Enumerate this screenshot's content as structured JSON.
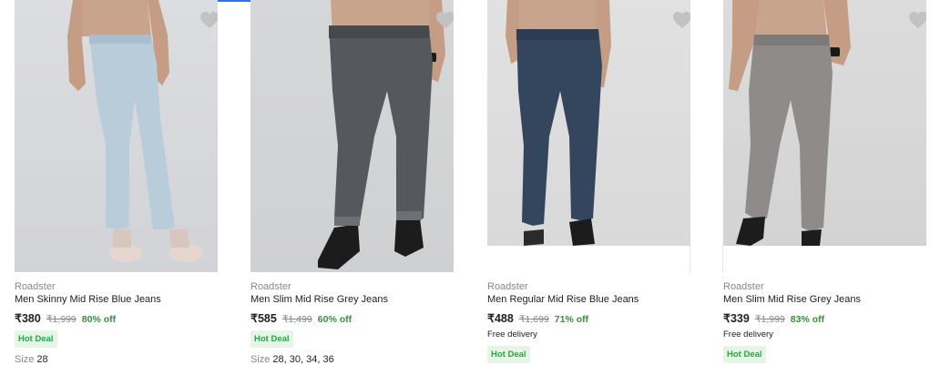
{
  "products": [
    {
      "brand": "Roadster",
      "title": "Men Skinny Mid Rise Blue Jeans",
      "price": "₹380",
      "mrp": "₹1,999",
      "discount": "80% off",
      "delivery": "",
      "badge": "Hot Deal",
      "size_label": "Size",
      "sizes": "28",
      "image_icon": "jeans-light-blue",
      "denim_color": "#b9ccd9"
    },
    {
      "brand": "Roadster",
      "title": "Men Slim Mid Rise Grey Jeans",
      "price": "₹585",
      "mrp": "₹1,499",
      "discount": "60% off",
      "delivery": "",
      "badge": "Hot Deal",
      "size_label": "Size",
      "sizes": "28, 30, 34, 36",
      "image_icon": "jeans-dark-grey",
      "denim_color": "#55585c"
    },
    {
      "brand": "Roadster",
      "title": "Men Regular Mid Rise Blue Jeans",
      "price": "₹488",
      "mrp": "₹1,699",
      "discount": "71% off",
      "delivery": "Free delivery",
      "badge": "Hot Deal",
      "size_label": "",
      "sizes": "",
      "image_icon": "jeans-dark-blue",
      "denim_color": "#34465e"
    },
    {
      "brand": "Roadster",
      "title": "Men Slim Mid Rise Grey Jeans",
      "price": "₹339",
      "mrp": "₹1,999",
      "discount": "83% off",
      "delivery": "Free delivery",
      "badge": "Hot Deal",
      "size_label": "",
      "sizes": "",
      "image_icon": "jeans-acid-grey",
      "denim_color": "#8f8b8b"
    }
  ],
  "colors": {
    "brand_text": "#878787",
    "discount_green": "#388e3c",
    "badge_bg": "#e6f6e6",
    "badge_text": "#26a541",
    "accent_blue": "#2874f0",
    "wishlist_heart": "#c2c2c2"
  },
  "icons": {
    "wishlist": "heart-icon"
  }
}
